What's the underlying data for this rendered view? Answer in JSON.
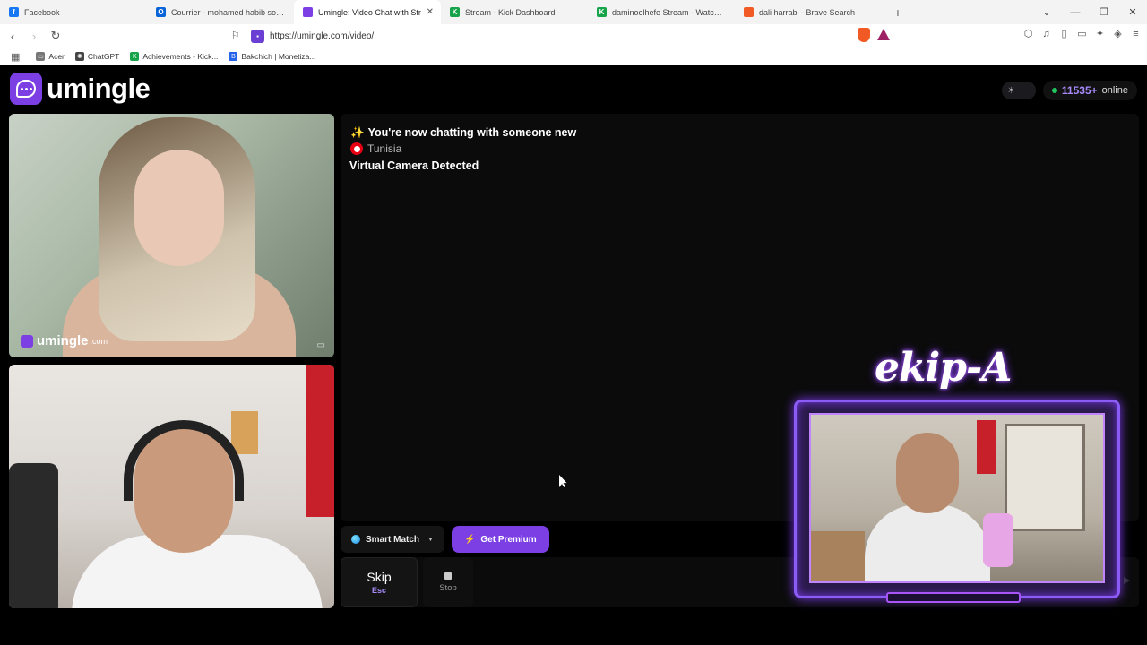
{
  "browser": {
    "tabs": [
      {
        "title": "Facebook",
        "favicon_color": "#1877f2",
        "favicon_glyph": "f"
      },
      {
        "title": "Courrier - mohamed habib souaied -",
        "favicon_color": "#0a64d8",
        "favicon_glyph": "O"
      },
      {
        "title": "Umingle: Video Chat with Str",
        "favicon_color": "#7b3fe4",
        "favicon_glyph": "",
        "active": true
      },
      {
        "title": "Stream - Kick Dashboard",
        "favicon_color": "#16a34a",
        "favicon_glyph": "K"
      },
      {
        "title": "daminoelhefe Stream - Watch Live o",
        "favicon_color": "#16a34a",
        "favicon_glyph": "K"
      },
      {
        "title": "dali harrabi - Brave Search",
        "favicon_color": "#f15a24",
        "favicon_glyph": ""
      }
    ],
    "new_tab_label": "+",
    "url": "https://umingle.com/video/",
    "bookmarks": [
      {
        "label": "Acer",
        "icon": "folder-icon",
        "color": "#777777"
      },
      {
        "label": "ChatGPT",
        "icon": "chatgpt-icon",
        "color": "#444444"
      },
      {
        "label": "Achievements - Kick...",
        "icon": "kick-icon",
        "color": "#16a34a"
      },
      {
        "label": "Bakchich | Monetiza...",
        "icon": "bakchich-icon",
        "color": "#2563eb"
      }
    ]
  },
  "site": {
    "logo_text": "umingle",
    "online_count": "11535+",
    "online_label": "online",
    "watermark_text": "umingle",
    "watermark_suffix": ".com"
  },
  "chat": {
    "line1": "You're now chatting with someone new",
    "country": "Tunisia",
    "line3": "Virtual Camera Detected"
  },
  "controls": {
    "smart_match_label": "Smart Match",
    "premium_label": "Get Premium",
    "skip_label": "Skip",
    "skip_key": "Esc",
    "stop_label": "Stop"
  },
  "overlay": {
    "title": "ekip-A"
  },
  "colors": {
    "brand": "#7b3fe4",
    "online_dot": "#22c55e",
    "accent_text": "#a78bfa",
    "overlay_glow": "#8b5cf6"
  }
}
